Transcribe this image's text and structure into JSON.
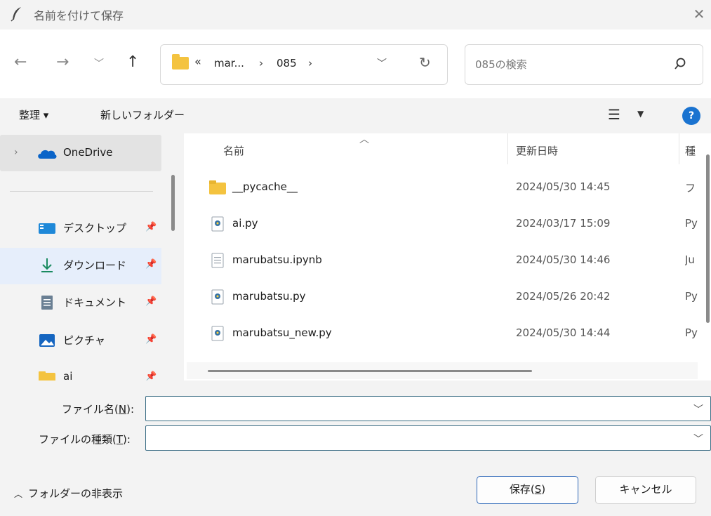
{
  "window": {
    "title": "名前を付けて保存"
  },
  "address": {
    "crumbs": [
      "mar...",
      "085"
    ]
  },
  "search": {
    "placeholder": "085の検索"
  },
  "toolbar": {
    "organize": "整理 ▾",
    "new_folder": "新しいフォルダー"
  },
  "sidebar": {
    "onedrive": "OneDrive",
    "items": [
      {
        "label": "デスクトップ",
        "icon": "desktop-icon"
      },
      {
        "label": "ダウンロード",
        "icon": "download-icon"
      },
      {
        "label": "ドキュメント",
        "icon": "document-icon"
      },
      {
        "label": "ピクチャ",
        "icon": "picture-icon"
      },
      {
        "label": "ai",
        "icon": "folder-icon"
      }
    ]
  },
  "columns": {
    "name": "名前",
    "date": "更新日時",
    "type": "種"
  },
  "files": [
    {
      "name": "__pycache__",
      "date": "2024/05/30 14:45",
      "type": "フ",
      "icon": "folder-icon"
    },
    {
      "name": "ai.py",
      "date": "2024/03/17 15:09",
      "type": "Py",
      "icon": "python-file-icon"
    },
    {
      "name": "marubatsu.ipynb",
      "date": "2024/05/30 14:46",
      "type": "Ju",
      "icon": "notebook-file-icon"
    },
    {
      "name": "marubatsu.py",
      "date": "2024/05/26 20:42",
      "type": "Py",
      "icon": "python-file-icon"
    },
    {
      "name": "marubatsu_new.py",
      "date": "2024/05/30 14:44",
      "type": "Py",
      "icon": "python-file-icon"
    }
  ],
  "form": {
    "filename_label": "ファイル名(",
    "filename_key": "N",
    "filetype_label": "ファイルの種類(",
    "filetype_key": "T",
    "filename_value": "",
    "filetype_value": ""
  },
  "footer": {
    "hide_folders": "フォルダーの非表示",
    "save_label": "保存(",
    "save_key": "S",
    "cancel_label": "キャンセル"
  },
  "colors": {
    "accent": "#2d67b8",
    "folder": "#f4c33f",
    "selected": "#e3e3e3"
  }
}
